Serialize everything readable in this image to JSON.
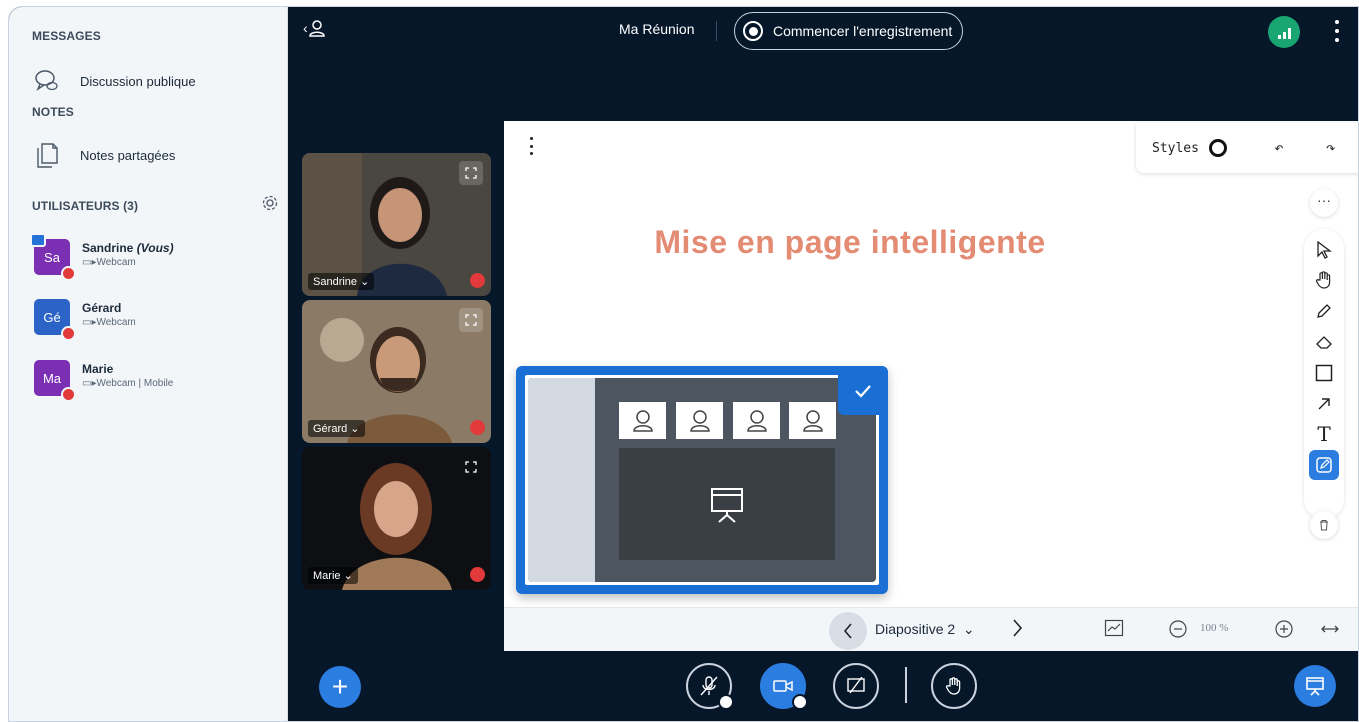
{
  "sidebar": {
    "messages_title": "MESSAGES",
    "public_chat": "Discussion publique",
    "notes_title": "NOTES",
    "shared_notes": "Notes partagées",
    "users_title": "UTILISATEURS (3)",
    "users": [
      {
        "initials": "Sa",
        "name": "Sandrine",
        "you": "(Vous)",
        "sub": "Webcam",
        "color": "#7b2fb3",
        "presenter": true
      },
      {
        "initials": "Gé",
        "name": "Gérard",
        "you": "",
        "sub": "Webcam",
        "color": "#2b63c6",
        "presenter": false
      },
      {
        "initials": "Ma",
        "name": "Marie",
        "you": "",
        "sub": "Webcam | Mobile",
        "color": "#7b2fb3",
        "presenter": false
      }
    ]
  },
  "topbar": {
    "meeting_title": "Ma Réunion",
    "record_label": "Commencer l'enregistrement"
  },
  "videos": [
    {
      "name": "Sandrine"
    },
    {
      "name": "Gérard"
    },
    {
      "name": "Marie"
    }
  ],
  "presentation": {
    "styles_label": "Styles",
    "slide_title": "Mise en page intelligente",
    "slide_label": "Diapositive 2",
    "zoom": "100 %"
  },
  "colors": {
    "accent": "#2b7de0",
    "background": "#06172a",
    "title": "#e38b73"
  }
}
